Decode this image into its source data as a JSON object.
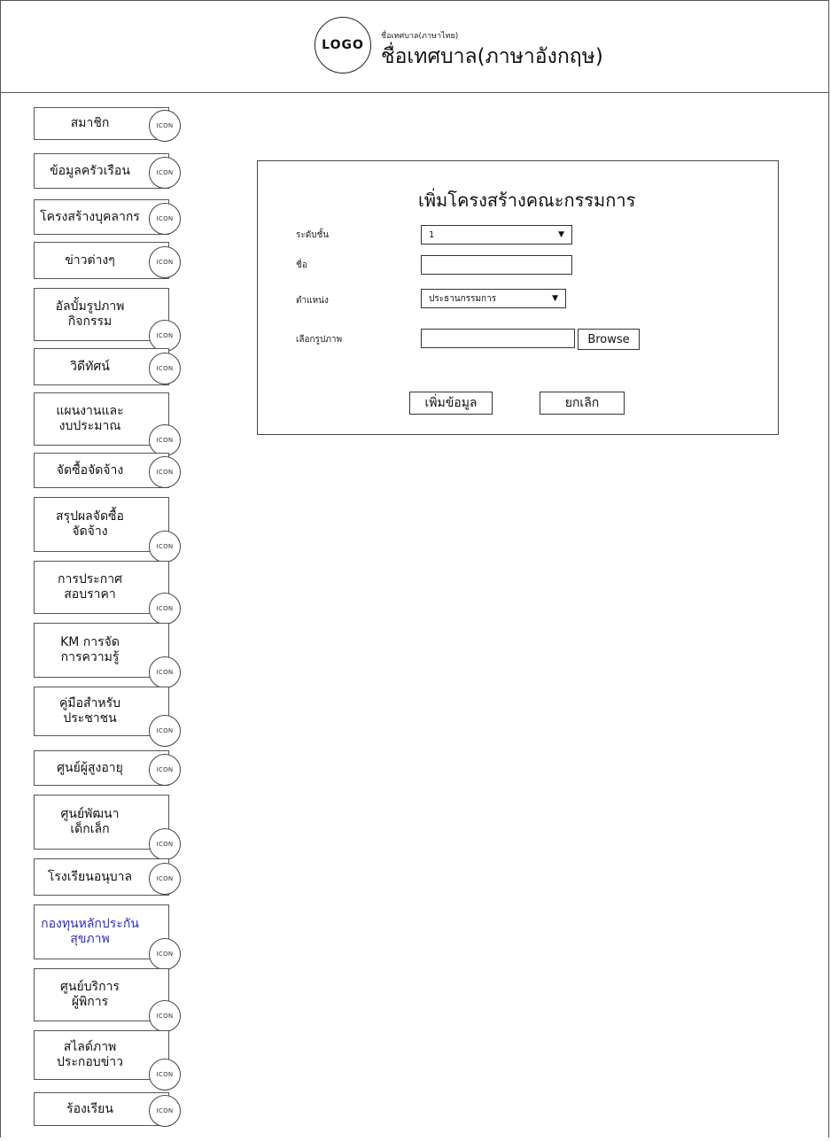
{
  "header": {
    "logo_text": "LOGO",
    "name_thai": "ชื่อเทศบาล(ภาษาไทย)",
    "name_english": "ชื่อเทศบาล(ภาษาอังกฤษ)"
  },
  "sidebar": {
    "icon_label": "ICON",
    "items": [
      {
        "lines": [
          "สมาชิก"
        ]
      },
      {
        "lines": [
          "ข้อมูลครัวเรือน"
        ]
      },
      {
        "lines": [
          "โครงสร้างบุคลากร"
        ]
      },
      {
        "lines": [
          "ข่าวต่างๆ"
        ]
      },
      {
        "lines": [
          "อัลบั้มรูปภาพ",
          "กิจกรรม"
        ]
      },
      {
        "lines": [
          "วิดีทัศน์"
        ]
      },
      {
        "lines": [
          "แผนงานและ",
          "งบประมาณ"
        ]
      },
      {
        "lines": [
          "จัดซื้อจัดจ้าง"
        ]
      },
      {
        "lines": [
          "สรุปผลจัดซื้อ",
          "จัดจ้าง"
        ]
      },
      {
        "lines": [
          "การประกาศ",
          "สอบราคา"
        ]
      },
      {
        "lines": [
          "KM การจัด",
          "การความรู้"
        ]
      },
      {
        "lines": [
          "คู่มือสำหรับ",
          "ประชาชน"
        ]
      },
      {
        "lines": [
          "ศูนย์ผู้สูงอายุ"
        ]
      },
      {
        "lines": [
          "ศูนย์พัฒนา",
          "เด็กเล็ก"
        ]
      },
      {
        "lines": [
          "โรงเรียนอนุบาล"
        ]
      },
      {
        "lines": [
          "กองทุนหลักประกัน",
          "สุขภาพ"
        ]
      },
      {
        "lines": [
          "ศูนย์บริการ",
          "ผู้พิการ"
        ]
      },
      {
        "lines": [
          "สไลด์ภาพ",
          "ประกอบข่าว"
        ]
      },
      {
        "lines": [
          "ร้องเรียน"
        ]
      }
    ]
  },
  "form": {
    "title": "เพิ่มโครงสร้างคณะกรรมการ",
    "level_label": "ระดับชั้น",
    "level_value": "1",
    "name_label": "ชื่อ",
    "name_value": "",
    "position_label": "ตำแหน่ง",
    "position_value": "ประธานกรรมการ",
    "image_label": "เลือกรูปภาพ",
    "image_value": "",
    "browse_label": "Browse",
    "submit_label": "เพิ่มข้อมูล",
    "cancel_label": "ยกเลิก",
    "dropdown_arrow": "▼"
  }
}
